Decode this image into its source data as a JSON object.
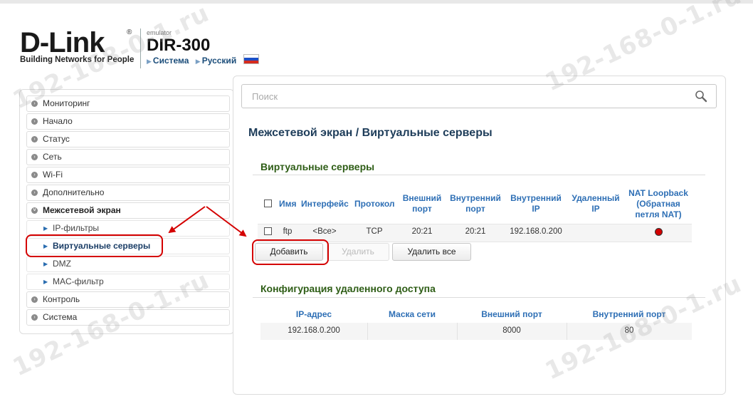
{
  "header": {
    "brand": "D-Link",
    "registered": "®",
    "tagline": "Building Networks for People",
    "emulator_label": "emulator",
    "model": "DIR-300",
    "crumb_system": "Система",
    "crumb_language": "Русский"
  },
  "sidebar": {
    "items": [
      {
        "label": "Мониторинг"
      },
      {
        "label": "Начало"
      },
      {
        "label": "Статус"
      },
      {
        "label": "Сеть"
      },
      {
        "label": "Wi-Fi"
      },
      {
        "label": "Дополнительно"
      },
      {
        "label": "Межсетевой экран"
      },
      {
        "label": "Контроль"
      },
      {
        "label": "Система"
      }
    ],
    "firewall_sub": [
      {
        "label": "IP-фильтры"
      },
      {
        "label": "Виртуальные серверы"
      },
      {
        "label": "DMZ"
      },
      {
        "label": "MAC-фильтр"
      }
    ]
  },
  "search": {
    "placeholder": "Поиск"
  },
  "page": {
    "title": "Межсетевой экран /  Виртуальные серверы"
  },
  "virtual_servers": {
    "section_title": "Виртуальные серверы",
    "columns": {
      "name": "Имя",
      "interface": "Интерфейс",
      "protocol": "Протокол",
      "ext_port_1": "Внешний",
      "ext_port_2": "порт",
      "int_port_1": "Внутренний",
      "int_port_2": "порт",
      "int_ip_1": "Внутренний",
      "int_ip_2": "IP",
      "remote_ip_1": "Удаленный",
      "remote_ip_2": "IP",
      "nat_1": "NAT Loopback",
      "nat_2": "(Обратная",
      "nat_3": "петля NAT)"
    },
    "rows": [
      {
        "name": "ftp",
        "interface": "<Все>",
        "protocol": "TCP",
        "ext_port": "20:21",
        "int_port": "20:21",
        "int_ip": "192.168.0.200",
        "remote_ip": ""
      }
    ],
    "buttons": {
      "add": "Добавить",
      "delete": "Удалить",
      "delete_all": "Удалить все"
    }
  },
  "remote_access": {
    "section_title": "Конфигурация удаленного доступа",
    "columns": {
      "ip": "IP-адрес",
      "mask": "Маска сети",
      "ext_port": "Внешний порт",
      "int_port": "Внутренний порт"
    },
    "rows": [
      {
        "ip": "192.168.0.200",
        "mask": "",
        "ext_port": "8000",
        "int_port": "80"
      }
    ]
  },
  "watermark": "192-168-0-1.ru",
  "colors": {
    "section_green": "#2e5d16",
    "header_blue": "#2e6fb5",
    "annotation_red": "#d40000"
  }
}
